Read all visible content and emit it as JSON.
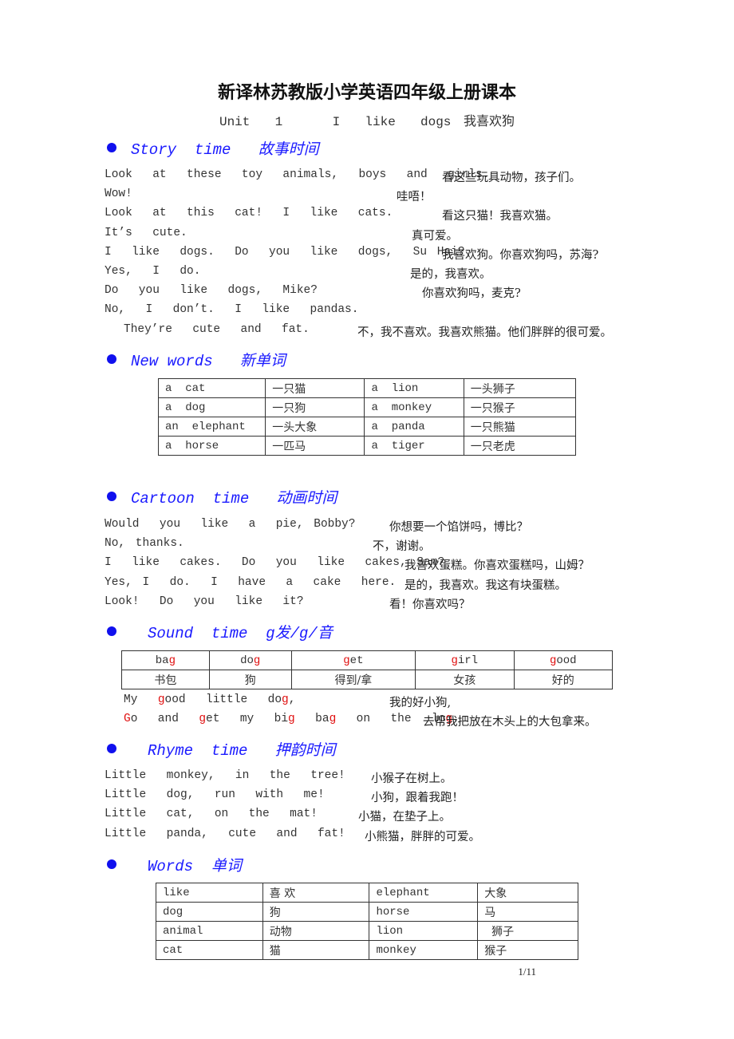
{
  "title": "新译林苏教版小学英语四年级上册课本",
  "subtitle": "Unit  1    I  like  dogs 我喜欢狗",
  "sections": {
    "story": {
      "heading": "Story  time   故事时间",
      "lines": [
        {
          "en": "Look  at  these  toy  animals,  boys  and  girls.",
          "zh": "看这些玩具动物，孩子们。"
        },
        {
          "en": "Wow!",
          "zh": "哇唔！"
        },
        {
          "en": "Look  at  this  cat!  I  like  cats.",
          "zh": "看这只猫！我喜欢猫。"
        },
        {
          "en": "It’s  cute.",
          "zh": "真可爱。"
        },
        {
          "en": "I  like  dogs.  Do  you  like  dogs,  Su Hai?",
          "zh": "我喜欢狗。你喜欢狗吗，苏海?"
        },
        {
          "en": "Yes,  I  do.",
          "zh": "是的，我喜欢。"
        },
        {
          "en": "Do  you  like  dogs,  Mike?",
          "zh": "你喜欢狗吗，麦克?"
        },
        {
          "en": "No,  I  don’t.  I  like  pandas.",
          "zh": ""
        },
        {
          "en": "They’re  cute  and  fat.",
          "zh": "不，我不喜欢。我喜欢熊猫。他们胖胖的很可爱。"
        }
      ]
    },
    "new_words": {
      "heading": "New words   新单词",
      "rows": [
        [
          "a  cat",
          "一只猫",
          "a  lion",
          "一头狮子"
        ],
        [
          "a  dog",
          "一只狗",
          "a  monkey",
          "一只猴子"
        ],
        [
          "an  elephant",
          "一头大象",
          "a  panda",
          "一只熊猫"
        ],
        [
          "a  horse",
          "一匹马",
          "a  tiger",
          "一只老虎"
        ]
      ]
    },
    "cartoon": {
      "heading": "Cartoon  time   动画时间",
      "lines": [
        {
          "en": "Would  you  like  a  pie, Bobby?",
          "zh": "你想要一个馅饼吗，博比？"
        },
        {
          "en": "No, thanks.",
          "zh": "不，谢谢。"
        },
        {
          "en": "I  like  cakes.  Do  you  like  cakes, Sam?",
          "zh": "我喜欢蛋糕。你喜欢蛋糕吗，山姆？"
        },
        {
          "en": "Yes, I  do.  I  have  a  cake  here.",
          "zh": "是的，我喜欢。我这有块蛋糕。"
        },
        {
          "en": "Look!  Do  you  like  it?",
          "zh": "看！你喜欢吗？"
        }
      ]
    },
    "sound": {
      "heading": "Sound  time  g发/g/音",
      "words": [
        {
          "pre": "ba",
          "g": "g",
          "post": ""
        },
        {
          "pre": "do",
          "g": "g",
          "post": ""
        },
        {
          "pre": "",
          "g": "g",
          "post": "et"
        },
        {
          "pre": "",
          "g": "g",
          "post": "irl"
        },
        {
          "pre": "",
          "g": "g",
          "post": "ood"
        }
      ],
      "meanings": [
        "书包",
        "狗",
        "得到/拿",
        "女孩",
        "好的"
      ],
      "line1_zh": "我的好小狗,",
      "line2_zh": "去帮我把放在木头上的大包拿来。",
      "line1": {
        "a": "My  ",
        "b": "g",
        "c": "ood  little  do",
        "d": "g",
        "e": ","
      },
      "line2": {
        "a": "G",
        "b": "o  and  ",
        "c": "g",
        "d": "et  my  bi",
        "e": "g",
        "f": "  ba",
        "g": "g",
        "h": "  on  the  lo",
        "i": "g",
        "j": "."
      }
    },
    "rhyme": {
      "heading": "Rhyme  time   押韵时间",
      "lines": [
        {
          "en": "Little  monkey,  in  the  tree!",
          "zh": "小猴子在树上。"
        },
        {
          "en": "Little  dog,  run  with  me!",
          "zh": "小狗，跟着我跑！"
        },
        {
          "en": "Little  cat,  on  the  mat!",
          "zh": "小猫，在垫子上。"
        },
        {
          "en": "Little  panda,  cute  and  fat!",
          "zh": "小熊猫，胖胖的可爱。"
        }
      ]
    },
    "words": {
      "heading": "Words  单词",
      "rows": [
        [
          "like",
          "喜 欢",
          "elephant",
          "大象"
        ],
        [
          "dog",
          "狗",
          "horse",
          "马"
        ],
        [
          "animal",
          "动物",
          "lion",
          "  狮子"
        ],
        [
          "cat",
          "猫",
          "monkey",
          "猴子"
        ]
      ]
    }
  },
  "page_number": "1/11",
  "colors": {
    "heading": "#1a1aff",
    "highlight": "#e01010"
  }
}
